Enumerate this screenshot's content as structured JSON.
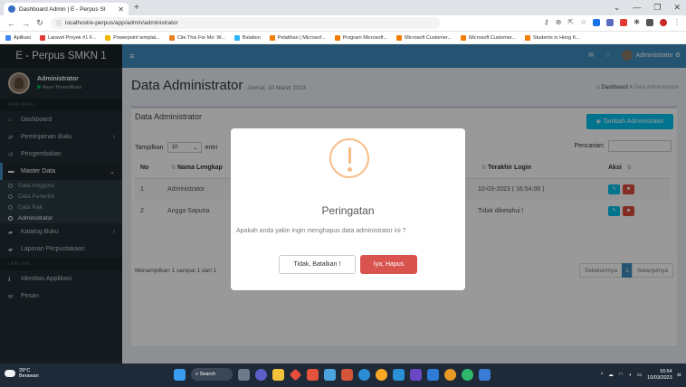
{
  "browser": {
    "tab_title": "Dashboard Admin | E - Perpus SI",
    "url": "localhost/e-perpus/app/admin/administrator",
    "bookmarks": [
      "Aplikasi",
      "Laravel Proyek #1 F...",
      "Powerpoint templat...",
      "Cite This For Me: W...",
      "Bstation",
      "Pelatihan | Microsof...",
      "Program Microsoft...",
      "Microsoft Customer...",
      "Microsoft Customer...",
      "Students in Hong K..."
    ]
  },
  "sidebar": {
    "brand": "E - Perpus SMKN 1",
    "user_name": "Administrator",
    "user_status": "Akun Terverifikasi",
    "section_main": "MAIN MENU",
    "items": [
      {
        "label": "Dashboard",
        "icon": "home-icon"
      },
      {
        "label": "Peminjaman Buku",
        "icon": "exchange-icon"
      },
      {
        "label": "Pengembalian",
        "icon": "refresh-icon"
      },
      {
        "label": "Master Data",
        "icon": "folder-icon"
      }
    ],
    "sub_items": [
      "Data Anggota",
      "Data Penerbit",
      "Data Rak",
      "Administrator"
    ],
    "items2": [
      {
        "label": "Katalog Buku",
        "icon": "book-icon"
      },
      {
        "label": "Laporan Perpustakaan",
        "icon": "report-icon"
      }
    ],
    "section_lain": "LAIN-LAIN",
    "items3": [
      {
        "label": "Identitas Applikasi",
        "icon": "info-icon"
      },
      {
        "label": "Pesan",
        "icon": "mail-icon"
      }
    ]
  },
  "topnav": {
    "user": "Administrator"
  },
  "content": {
    "title": "Data Administrator",
    "date": "Jum'at, 10 Maret 2023",
    "breadcrumb_home": "Dashboard",
    "breadcrumb_sep": ">",
    "breadcrumb_current": "Data Administrator",
    "box_title": "Data Administrator",
    "add_button": "Tambah Administrator",
    "show_label": "Tampilkan",
    "show_value": "10",
    "entries_label": "entri",
    "search_label": "Pencarian:",
    "columns": [
      "No",
      "Nama Lengkap",
      "Terakhir Login",
      "Aksi"
    ],
    "rows": [
      {
        "no": "1",
        "nama": "Administrator",
        "login": "10-03-2023 ( 16:54:00 )"
      },
      {
        "no": "2",
        "nama": "Angga Saputra",
        "login": "Tidak diketahui !"
      }
    ],
    "footer_info": "Menampilkan 1 sampai 1 dari 1",
    "prev": "Sebelumnya",
    "page": "1",
    "next": "Selanjutnya"
  },
  "modal": {
    "title": "Peringatan",
    "text": "Apakah anda yakin ingin menghapus data administrator ini ?",
    "cancel": "Tidak, Batalkan !",
    "confirm": "Iya, Hapus"
  },
  "taskbar": {
    "temp": "29°C",
    "weather": "Berawan",
    "search": "Search",
    "time": "16:54",
    "date": "10/03/2023"
  },
  "colors": {
    "primary": "#3c8dbc",
    "sidebar": "#222d32",
    "info": "#00c0ef",
    "danger": "#d9534f",
    "warning": "#f8bb86"
  }
}
